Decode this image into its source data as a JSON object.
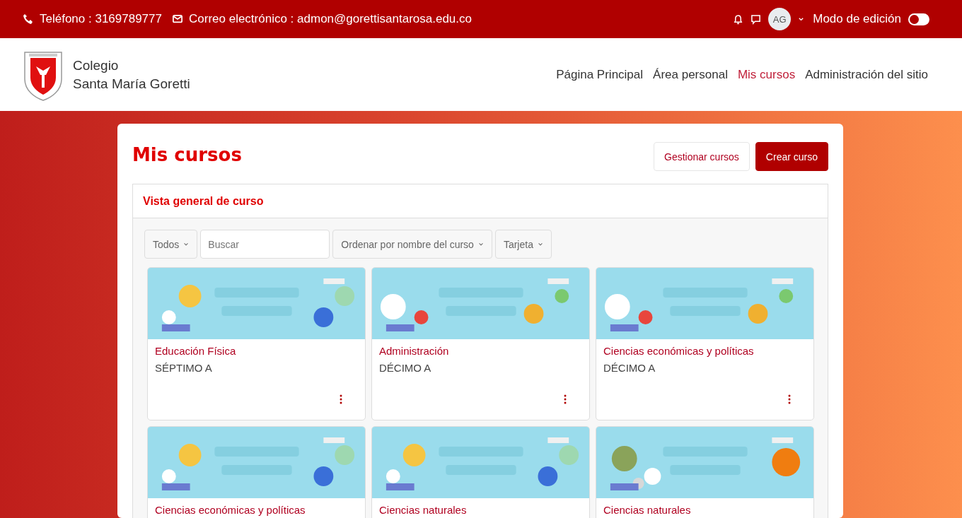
{
  "top_bar": {
    "phone": "Teléfono : 3169789777",
    "email": "Correo electrónico : admon@gorettisantarosa.edu.co",
    "avatar": "AG",
    "edit_mode_label": "Modo de edición",
    "edit_mode_on": false
  },
  "header": {
    "site_name_line1": "Colegio",
    "site_name_line2": "Santa María Goretti",
    "nav": [
      {
        "label": "Página Principal",
        "selected": false
      },
      {
        "label": "Área personal",
        "selected": false
      },
      {
        "label": "Mis cursos",
        "selected": true
      },
      {
        "label": "Administración del sitio",
        "selected": false
      }
    ]
  },
  "page": {
    "title": "Mis cursos",
    "buttons": [
      {
        "label": "Gestionar cursos",
        "kind": "secondary"
      },
      {
        "label": "Crear curso",
        "kind": "primary"
      }
    ]
  },
  "overview": {
    "title": "Vista general de curso",
    "filters": [
      {
        "kind": "dropdown",
        "label": "Todos"
      },
      {
        "kind": "search",
        "placeholder": "Buscar"
      },
      {
        "kind": "dropdown",
        "label": "Ordenar por nombre del curso"
      },
      {
        "kind": "dropdown",
        "label": "Tarjeta"
      }
    ],
    "courses": [
      {
        "name": "Educación Física",
        "group": "SÉPTIMO A"
      },
      {
        "name": "Administración",
        "group": "DÉCIMO A"
      },
      {
        "name": "Ciencias económicas y políticas",
        "group": "DÉCIMO A"
      },
      {
        "name": "Ciencias económicas y políticas"
      },
      {
        "name": "Ciencias naturales"
      },
      {
        "name": "Ciencias naturales"
      }
    ]
  }
}
